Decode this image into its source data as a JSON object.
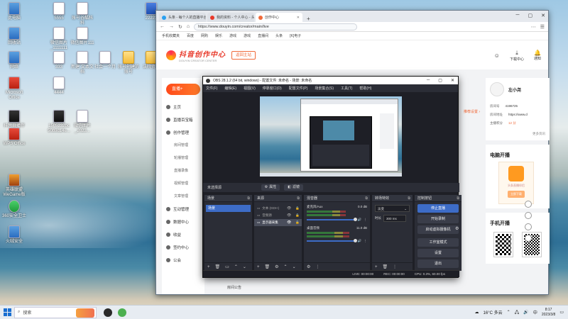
{
  "desktop": {
    "icons": [
      {
        "label": "此电脑",
        "icon": "computer-icon",
        "kind": "pc"
      },
      {
        "label": "5555",
        "icon": "document-icon",
        "kind": "doc"
      },
      {
        "label": "账号谷酷科科",
        "icon": "document-icon",
        "kind": "doc"
      },
      {
        "label": "22222",
        "icon": "word-icon",
        "kind": "word"
      },
      {
        "label": "回收站",
        "icon": "recycle-bin-icon",
        "kind": "pc"
      },
      {
        "label": "微信图片_1111111",
        "icon": "image-icon",
        "kind": "doc"
      },
      {
        "label": "微信图片111",
        "icon": "image-icon",
        "kind": "doc"
      },
      {
        "label": "网络",
        "icon": "network-icon",
        "kind": "pc"
      },
      {
        "label": "333",
        "icon": "document-icon",
        "kind": "doc"
      },
      {
        "label": "新建 文本文档",
        "icon": "text-file-icon",
        "kind": "doc"
      },
      {
        "label": "社会一个月",
        "icon": "document-icon",
        "kind": "doc"
      },
      {
        "label": "账号创建的账号",
        "icon": "folder-icon",
        "kind": "folder"
      },
      {
        "label": "法院资料",
        "icon": "folder-icon",
        "kind": "folder"
      },
      {
        "label": "Microsoft Office",
        "icon": "office-icon",
        "kind": "red"
      },
      {
        "label": "4444",
        "icon": "document-icon",
        "kind": "doc"
      },
      {
        "label": "抖音直播伴侣",
        "icon": "video-icon",
        "kind": "vid"
      },
      {
        "label": "1505232bc 50b9d14e...",
        "icon": "video-icon",
        "kind": "vid"
      },
      {
        "label": "微信图片_2023...",
        "icon": "image-icon",
        "kind": "doc"
      },
      {
        "label": "WPS Office",
        "icon": "wps-icon",
        "kind": "red"
      },
      {
        "label": "英雄联盟 WeGame版",
        "icon": "game-icon",
        "kind": "game"
      },
      {
        "label": "360安全卫士",
        "icon": "security-icon",
        "kind": "green"
      },
      {
        "label": "火绒安全",
        "icon": "shield-icon",
        "kind": "pc"
      }
    ]
  },
  "browser": {
    "tabs": [
      {
        "title": "头条 - 每个人的直播平台",
        "active": false
      },
      {
        "title": "我的资料 - 个人中心 - 头条",
        "active": false
      },
      {
        "title": "创作中心",
        "active": true
      }
    ],
    "url": "https://www.douyin.com/creator/main/live",
    "bookmarks": [
      "手机收藏夹",
      "百度",
      "网购",
      "娱乐",
      "游戏",
      "游戏",
      "直播间",
      "头条",
      "[K]电子"
    ],
    "header": {
      "brand": "抖音创作中心",
      "brand_sub": "DOUYIN CREATOR CENTER",
      "home_button": "返回主站",
      "actions": [
        {
          "label": "",
          "icon": "user-icon"
        },
        {
          "label": "下载中心",
          "icon": "download-icon"
        },
        {
          "label": "通知",
          "icon": "bell-icon"
        }
      ]
    },
    "nav": {
      "live_button": "直播+",
      "items": [
        {
          "label": "主页",
          "icon": "home-icon",
          "sub": false
        },
        {
          "label": "直播百宝箱",
          "icon": "box-icon",
          "sub": false
        },
        {
          "label": "创作管理",
          "icon": "edit-icon",
          "sub": false
        },
        {
          "label": "房间管理",
          "sub": true
        },
        {
          "label": "轮播管理",
          "sub": true
        },
        {
          "label": "直播录像",
          "sub": true
        },
        {
          "label": "视频管理",
          "sub": true
        },
        {
          "label": "文章管理",
          "sub": true
        },
        {
          "label": "互动管理",
          "icon": "chat-icon",
          "sub": false
        },
        {
          "label": "数据中心",
          "icon": "chart-icon",
          "sub": false
        },
        {
          "label": "收益",
          "icon": "coin-icon",
          "sub": false
        },
        {
          "label": "签约中心",
          "icon": "sign-icon",
          "sub": false
        },
        {
          "label": "公会",
          "icon": "group-icon",
          "sub": false
        }
      ]
    },
    "profile": {
      "name": "左小尧",
      "rows": [
        {
          "k": "房间号",
          "v": "4196725"
        },
        {
          "k": "房间地址",
          "v": "https://www.d"
        },
        {
          "k": "主播积分",
          "v": "12 分"
        }
      ],
      "more": "更多资讯"
    },
    "pc_live": {
      "title": "电脑开播",
      "desc": "头条直播伴侣",
      "btn": "立即下载"
    },
    "mobile_live": {
      "title": "手机开播"
    },
    "notice": "房间公告",
    "orange_note": "推荐设置 ›"
  },
  "obs": {
    "title": "OBS 28.1.2 (64 bit, windows) - 配置文件: 未命名 - 场景: 未命名",
    "menu": [
      "文件(F)",
      "编辑(E)",
      "视图(V)",
      "停靠窗口(D)",
      "配置文件(P)",
      "场景集合(S)",
      "工具(T)",
      "帮助(H)"
    ],
    "source_bar": {
      "label": "未选择源",
      "properties": "属性",
      "filters": "滤镜"
    },
    "docks": {
      "scenes": {
        "title": "场景",
        "items": [
          "场景"
        ]
      },
      "sources": {
        "title": "来源",
        "items": [
          {
            "name": "文本 (GDI+)",
            "selected": false
          },
          {
            "name": "音频源",
            "selected": false
          },
          {
            "name": "显示器采集",
            "selected": true
          }
        ]
      },
      "mixer": {
        "title": "混音器",
        "channels": [
          {
            "name": "麦克风/Aux",
            "db": "0.0 dB",
            "level": 0.65
          },
          {
            "name": "桌面音频",
            "db": "11.0 dB",
            "level": 0.7
          }
        ]
      },
      "transitions": {
        "title": "转场特效",
        "selected": "淡变",
        "duration_label": "时长",
        "duration": "300 ms"
      },
      "controls": {
        "title": "控制按钮",
        "buttons": [
          "停止直播",
          "开始录制",
          "启动虚拟摄像机",
          "工作室模式",
          "设置",
          "退出"
        ]
      }
    },
    "status": {
      "live": "LIVE: 00:00:00",
      "rec": "REC: 00:00:00",
      "cpu": "CPU: 0.3%, 60.00 fps"
    }
  },
  "taskbar": {
    "search_placeholder": "搜索",
    "weather": "16°C  多云",
    "time": "8:17",
    "date": "2023/3/8",
    "apps": [
      {
        "icon": "obs-icon",
        "color": "#2a2a2a"
      },
      {
        "icon": "browser-icon",
        "color": "#4cb050"
      }
    ]
  }
}
